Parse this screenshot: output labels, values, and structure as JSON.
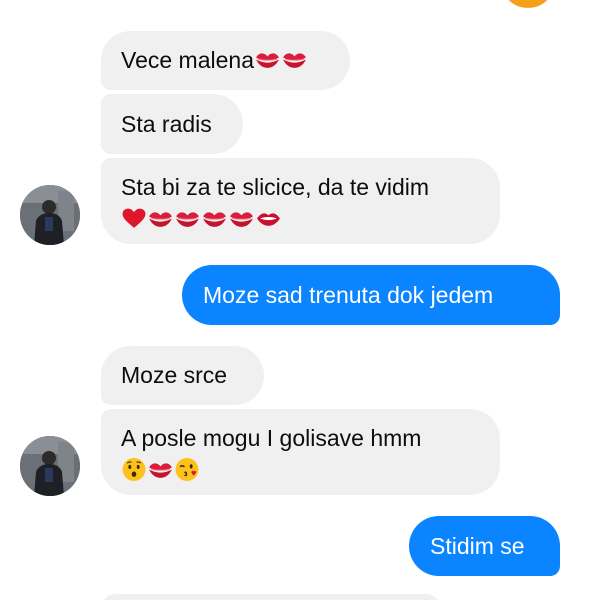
{
  "conversation": {
    "messages": [
      {
        "id": "m1",
        "direction": "incoming",
        "text": "Vece malena",
        "emojis": [
          "kiss-mark",
          "kiss-mark"
        ]
      },
      {
        "id": "m2",
        "direction": "incoming",
        "text": "Sta radis",
        "emojis": []
      },
      {
        "id": "m3",
        "direction": "incoming",
        "text": "Sta bi za te slicice, da te vidim",
        "emojis": [
          "red-heart",
          "kiss-mark",
          "kiss-mark",
          "kiss-mark",
          "kiss-mark",
          "mouth"
        ]
      },
      {
        "id": "m4",
        "direction": "outgoing",
        "text": "Moze sad trenuta dok jedem",
        "emojis": []
      },
      {
        "id": "m5",
        "direction": "incoming",
        "text": "Moze srce",
        "emojis": []
      },
      {
        "id": "m6",
        "direction": "incoming",
        "text": "A posle mogu I golisave hmm",
        "emojis": [
          "hushed-face",
          "kiss-mark",
          "face-blowing-kiss"
        ]
      },
      {
        "id": "m7",
        "direction": "outgoing",
        "text": "Stidim se",
        "emojis": []
      }
    ]
  },
  "colors": {
    "incoming_bubble": "#f0f0f0",
    "outgoing_bubble": "#0a84ff",
    "outgoing_text": "#ffffff",
    "incoming_text": "#0d0d0d",
    "own_avatar": "#f5a01a"
  },
  "icons": {
    "contact_avatar": "person-avatar",
    "own_avatar": "orange-avatar"
  }
}
